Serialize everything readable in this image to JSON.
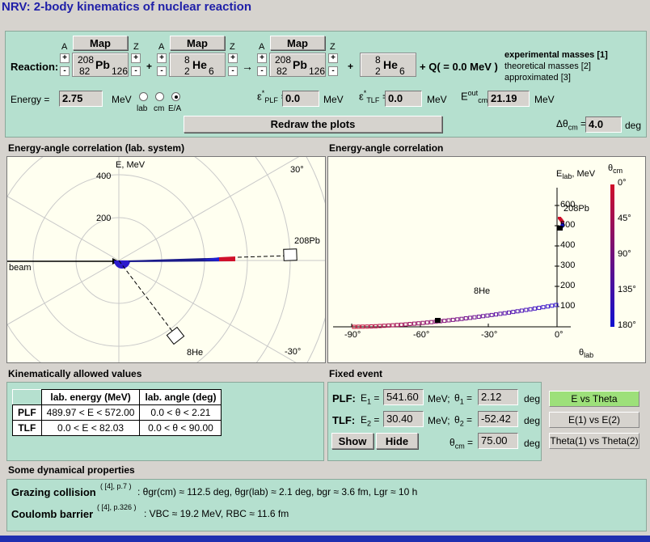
{
  "title": "NRV: 2-body kinematics of nuclear reaction",
  "reaction": {
    "label": "Reaction:",
    "map": "Map",
    "plus": "+",
    "minus": "-",
    "a_label": "A",
    "z_label": "Z",
    "nuclei": [
      {
        "a": "208",
        "z": "82",
        "sym": "Pb",
        "n": "126"
      },
      {
        "a": "8",
        "z": "2",
        "sym": "He",
        "n": "6"
      },
      {
        "a": "208",
        "z": "82",
        "sym": "Pb",
        "n": "126"
      },
      {
        "a": "8",
        "z": "2",
        "sym": "He",
        "n": "6"
      }
    ],
    "arrow": "→",
    "q": "+ Q( = 0.0 MeV )",
    "masses": [
      "experimental masses [1]",
      "theoretical masses [2]",
      "approximated [3]"
    ]
  },
  "energy": {
    "label": "Energy =",
    "value": "2.75",
    "unit": "MeV",
    "options": [
      "lab",
      "cm",
      "E/A"
    ],
    "selected": "E/A",
    "eplf_label": "ε*PLF =",
    "eplf": "0.0",
    "etlf_label": "ε*TLF =",
    "etlf": "0.0",
    "ecm_label": "E out cm =",
    "ecm": "21.19",
    "mev": "MeV",
    "dtheta_label": "Δθcm =",
    "dtheta": "4.0",
    "deg": "deg",
    "redraw": "Redraw the plots"
  },
  "plot1": {
    "title": "Energy-angle correlation (lab. system)",
    "ylabel": "E, MeV",
    "ticks": [
      "400",
      "200"
    ],
    "angle_top": "30°",
    "angle_bottom": "-30°",
    "beam": "beam",
    "pb_label": "208Pb",
    "he_label": "8He"
  },
  "plot2": {
    "title": "Energy-angle correlation",
    "ylabel": "Elab, MeV",
    "xlabel": "θlab",
    "yticks": [
      "600",
      "500",
      "400",
      "300",
      "200",
      "100"
    ],
    "xticks": [
      "-90°",
      "-60°",
      "-30°",
      "0°"
    ],
    "cbar_label": "θcm",
    "cbar_ticks": [
      "0°",
      "45°",
      "90°",
      "135°",
      "180°"
    ],
    "pb_label": "208Pb",
    "he_label": "8He"
  },
  "kin": {
    "title": "Kinematically allowed values",
    "headers": [
      "lab. energy (MeV)",
      "lab. angle (deg)"
    ],
    "rows": [
      {
        "name": "PLF",
        "energy": "489.97 < E < 572.00",
        "angle": "0.0 < θ < 2.21"
      },
      {
        "name": "TLF",
        "energy": "0.0 < E < 82.03",
        "angle": "0.0 < θ < 90.00"
      }
    ]
  },
  "fixed": {
    "title": "Fixed event",
    "plf": "PLF:",
    "tlf": "TLF:",
    "e1_label": "E1 =",
    "e1": "541.60",
    "t1_label": "θ1 =",
    "t1": "2.12",
    "e2_label": "E2 =",
    "e2": "30.40",
    "t2_label": "θ2 =",
    "t2": "-52.42",
    "tcm_label": "θcm =",
    "tcm": "75.00",
    "mev": "MeV;",
    "deg": "deg",
    "show": "Show",
    "hide": "Hide"
  },
  "views": [
    "E vs Theta",
    "E(1) vs E(2)",
    "Theta(1) vs Theta(2)"
  ],
  "dyn": {
    "title": "Some dynamical properties",
    "grazing_label": "Grazing collision",
    "grazing_ref": "( [4], p.7 )",
    "grazing_text": ": θgr(cm) ≈ 112.5 deg, θgr(lab) ≈ 2.1 deg, bgr ≈ 3.6 fm, Lgr ≈ 10 h",
    "coulomb_label": "Coulomb barrier",
    "coulomb_ref": "( [4], p.326 )",
    "coulomb_text": ": VBC ≈ 19.2 MeV, RBC ≈ 11.6 fm"
  },
  "colors": {
    "panel": "#b5e0cf",
    "title": "#1f1fa8",
    "active_view": "#9de07a",
    "plf_line": "#1a1a8a",
    "red": "#d0102a",
    "blue": "#1010d0"
  }
}
